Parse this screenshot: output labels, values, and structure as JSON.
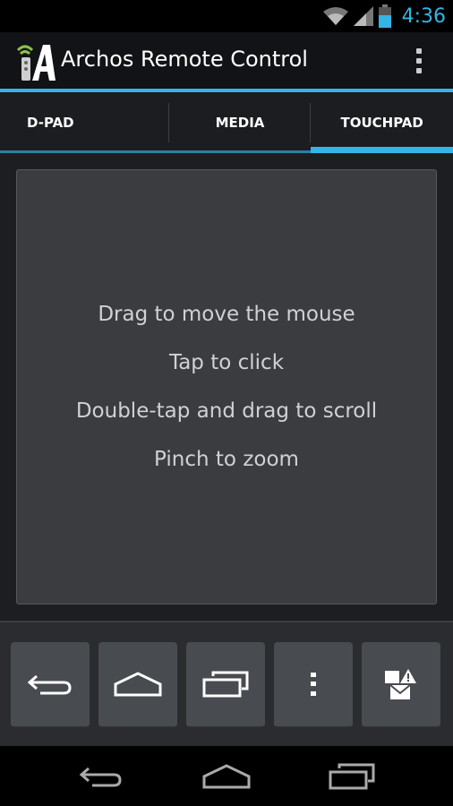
{
  "status_bar": {
    "time": "4:36",
    "icons": [
      "wifi-icon",
      "signal-icon",
      "battery-icon"
    ],
    "accent_color": "#33b5e5"
  },
  "action_bar": {
    "title": "Archos Remote Control",
    "icon": "archos-remote-app-icon",
    "overflow_icon": "overflow-menu-icon"
  },
  "tabs": [
    {
      "label": "D-PAD",
      "active": false
    },
    {
      "label": "MEDIA",
      "active": false
    },
    {
      "label": "TOUCHPAD",
      "active": true
    }
  ],
  "touchpad": {
    "instructions": [
      "Drag to move the mouse",
      "Tap to click",
      "Double-tap and drag to scroll",
      "Pinch to zoom"
    ]
  },
  "controls": [
    {
      "name": "back-button",
      "icon": "back-arrow-icon"
    },
    {
      "name": "home-button",
      "icon": "home-icon"
    },
    {
      "name": "recent-apps-button",
      "icon": "recent-apps-icon"
    },
    {
      "name": "menu-button",
      "icon": "overflow-menu-icon"
    },
    {
      "name": "notifications-button",
      "icon": "notification-alert-icon"
    }
  ],
  "system_nav": [
    "back-icon",
    "home-icon",
    "recent-apps-icon"
  ]
}
